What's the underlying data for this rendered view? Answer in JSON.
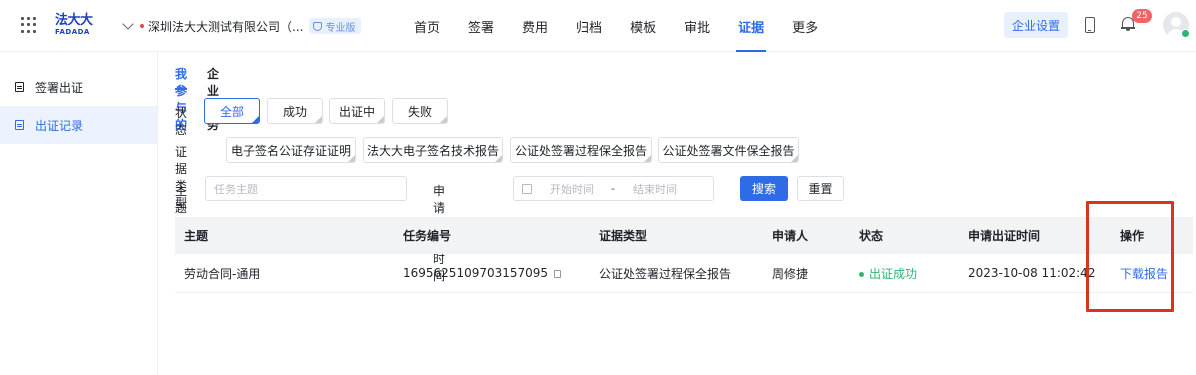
{
  "header": {
    "logo_cn": "法大大",
    "logo_en": "FADADA",
    "company_name": "深圳法大大测试有限公司（...",
    "plan_badge": "专业版",
    "nav": [
      {
        "label": "首页"
      },
      {
        "label": "签署"
      },
      {
        "label": "费用"
      },
      {
        "label": "归档"
      },
      {
        "label": "模板"
      },
      {
        "label": "审批"
      },
      {
        "label": "证据",
        "active": true
      },
      {
        "label": "更多"
      }
    ],
    "enterprise_settings": "企业设置",
    "notification_count": "25"
  },
  "sidebar": {
    "items": [
      {
        "label": "签署出证"
      },
      {
        "label": "出证记录",
        "active": true
      }
    ]
  },
  "subtabs": [
    {
      "label": "我参与的",
      "active": true
    },
    {
      "label": "企业任务"
    }
  ],
  "filters": {
    "status_label": "状态",
    "status_options": [
      "全部",
      "成功",
      "出证中",
      "失败"
    ],
    "status_selected": "全部",
    "type_label": "证据类型",
    "type_options": [
      "电子签名公证存证证明",
      "法大大电子签名技术报告",
      "公证处签署过程保全报告",
      "公证处签署文件保全报告"
    ],
    "subject_label": "主题",
    "subject_placeholder": "任务主题",
    "time_label": "申请出证时间",
    "start_placeholder": "开始时间",
    "range_sep": "-",
    "end_placeholder": "结束时间",
    "search_button": "搜索",
    "reset_button": "重置"
  },
  "table": {
    "columns": [
      "主题",
      "任务编号",
      "证据类型",
      "申请人",
      "状态",
      "申请出证时间",
      "操作"
    ],
    "rows": [
      {
        "subject": "劳动合同-通用",
        "task_no": "1695625109703157095",
        "type": "公证处签署过程保全报告",
        "applicant": "周修捷",
        "status": "出证成功",
        "time": "2023-10-08 11:02:42",
        "action": "下载报告"
      }
    ]
  },
  "colors": {
    "accent": "#2e6be6",
    "success": "#2bb673",
    "highlight": "#d6361f",
    "badge": "#f26363"
  }
}
